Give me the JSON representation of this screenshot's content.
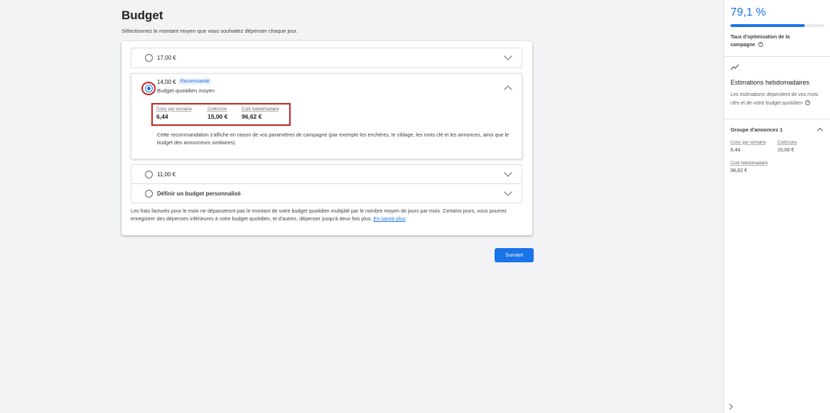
{
  "page": {
    "title": "Budget",
    "subtitle": "Sélectionnez le montant moyen que vous souhaitez dépenser chaque jour."
  },
  "options": [
    {
      "label": "17,00 €"
    },
    {
      "label": "14,00 €",
      "badge": "Recommandé",
      "sublabel": "Budget quotidien moyen",
      "metrics": [
        {
          "label": "Conv. par semaine",
          "value": "6,44"
        },
        {
          "label": "Coût/conv.",
          "value": "15,00 €"
        },
        {
          "label": "Coût hebdomadaire",
          "value": "96,62 €"
        }
      ],
      "description": "Cette recommandation s'affiche en raison de vos paramètres de campagne (par exemple les enchères, le ciblage, les mots clé et les annonces, ainsi que le budget des annonceurs similaires)."
    },
    {
      "label": "11,00 €"
    },
    {
      "label": "Définir un budget personnalisé"
    }
  ],
  "footer": {
    "text": "Les frais facturés pour le mois ne dépasseront pas le montant de votre budget quotidien multiplié par le nombre moyen de jours par mois. Certains jours, vous pourrez enregistrer des dépenses inférieures à votre budget quotidien, et d'autres, dépenser jusqu'à deux fois plus.",
    "link": "En savoir plus"
  },
  "next_button": "Suivant",
  "sidebar": {
    "score": "79,1 %",
    "score_fraction": 0.791,
    "score_label": "Taux d'optimisation de la campagne",
    "estimates_title": "Estimations hebdomadaires",
    "estimates_text": "Les estimations dépendent de vos mots clés et de votre budget quotidien",
    "group_title": "Groupe d'annonces 1",
    "metrics": [
      {
        "label": "Conv. par semaine",
        "value": "6,44"
      },
      {
        "label": "Coût/conv.",
        "value": "15,00 €"
      },
      {
        "label": "Coût hebdomadaire",
        "value": "96,62 €"
      }
    ]
  },
  "colors": {
    "accent": "#1a73e8",
    "highlight": "#c5221f"
  },
  "icons": [
    "help-icon",
    "trend-icon",
    "chevron-down-icon",
    "chevron-up-icon",
    "chevron-right-icon"
  ]
}
